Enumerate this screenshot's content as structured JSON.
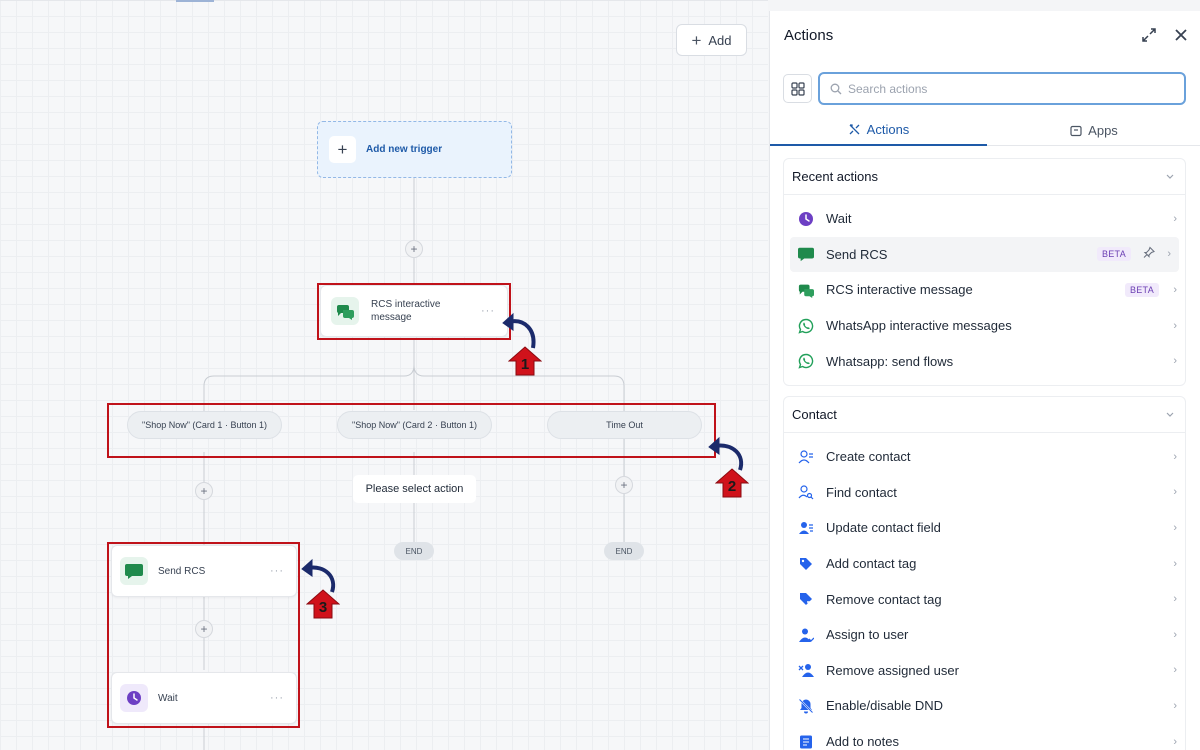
{
  "canvas": {
    "add_button": "Add",
    "trigger_label": "Add new trigger",
    "nodes": {
      "rcs_interactive": "RCS interactive message",
      "send_rcs": "Send RCS",
      "wait": "Wait"
    },
    "branches": [
      "\"Shop Now\" (Card 1 · Button 1)",
      "\"Shop Now\" (Card 2 · Button 1)",
      "Time Out"
    ],
    "select_action": "Please select action",
    "end_label": "END",
    "annotations": [
      "1",
      "2",
      "3"
    ],
    "colors": {
      "annotation_red": "#c0121a",
      "arrow_navy": "#1b2a6b",
      "rcs_green": "#1f8a4c",
      "wait_purple": "#6d3fc4"
    }
  },
  "panel": {
    "title": "Actions",
    "search_placeholder": "Search actions",
    "tabs": [
      {
        "label": "Actions",
        "icon": "tools-icon",
        "active": true
      },
      {
        "label": "Apps",
        "icon": "app-window-icon",
        "active": false
      }
    ],
    "recent": {
      "title": "Recent actions",
      "items": [
        {
          "label": "Wait",
          "icon": "clock-icon"
        },
        {
          "label": "Send RCS",
          "icon": "chat-bubble-icon",
          "badge": "BETA",
          "pinned": true
        },
        {
          "label": "RCS interactive message",
          "icon": "chat-bubbles-icon",
          "badge": "BETA"
        },
        {
          "label": "WhatsApp interactive messages",
          "icon": "whatsapp-icon"
        },
        {
          "label": "Whatsapp: send flows",
          "icon": "whatsapp-icon"
        }
      ]
    },
    "contact": {
      "title": "Contact",
      "items": [
        {
          "label": "Create contact",
          "icon": "user-plus-icon"
        },
        {
          "label": "Find contact",
          "icon": "user-search-icon"
        },
        {
          "label": "Update contact field",
          "icon": "user-edit-icon"
        },
        {
          "label": "Add contact tag",
          "icon": "tag-icon"
        },
        {
          "label": "Remove contact tag",
          "icon": "tag-remove-icon"
        },
        {
          "label": "Assign to user",
          "icon": "user-assign-icon"
        },
        {
          "label": "Remove assigned user",
          "icon": "user-remove-icon"
        },
        {
          "label": "Enable/disable DND",
          "icon": "bell-off-icon"
        },
        {
          "label": "Add to notes",
          "icon": "note-icon"
        }
      ]
    }
  }
}
